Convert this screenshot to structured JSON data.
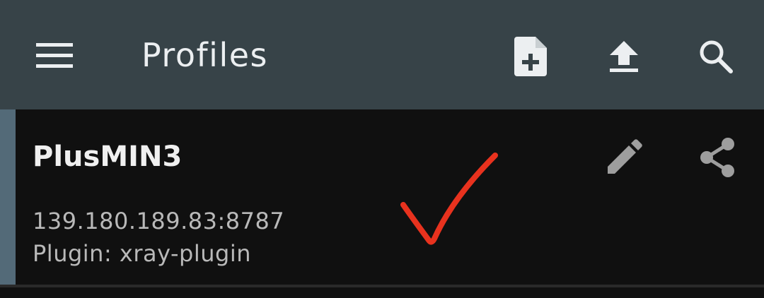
{
  "appbar": {
    "title": "Profiles",
    "menu_icon": "hamburger-menu-icon",
    "actions": [
      {
        "name": "new-profile",
        "icon": "file-add-icon"
      },
      {
        "name": "import",
        "icon": "upload-icon"
      },
      {
        "name": "search",
        "icon": "search-icon"
      }
    ],
    "background": "#374348"
  },
  "profile": {
    "name": "PlusMIN3",
    "address": "139.180.189.83:8787",
    "plugin": "Plugin: xray-plugin",
    "selected": true,
    "actions": [
      {
        "name": "edit",
        "icon": "pencil-icon"
      },
      {
        "name": "share",
        "icon": "share-icon"
      }
    ]
  },
  "annotation": {
    "mark": "red-checkmark",
    "color": "#e8321e"
  }
}
